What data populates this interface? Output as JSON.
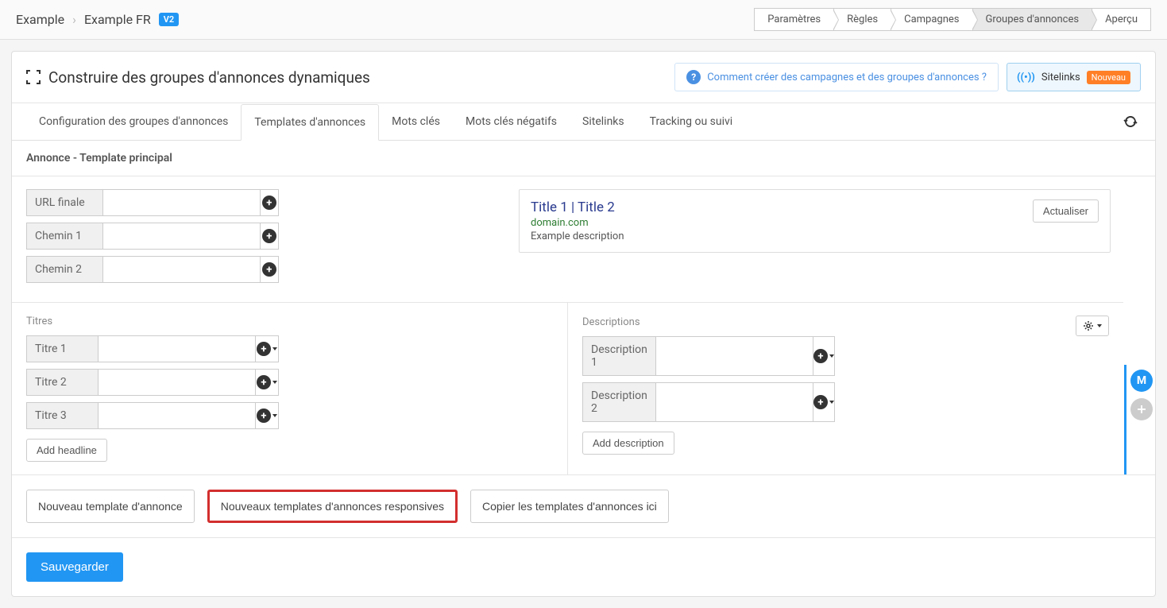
{
  "breadcrumb": {
    "item1": "Example",
    "item2": "Example FR",
    "badge": "V2"
  },
  "steps": {
    "parametres": "Paramètres",
    "regles": "Règles",
    "campagnes": "Campagnes",
    "groupes": "Groupes d'annonces",
    "apercu": "Aperçu"
  },
  "header": {
    "title": "Construire des groupes d'annonces dynamiques",
    "help": "Comment créer des campagnes et des groupes d'annonces ?",
    "sitelinks": "Sitelinks",
    "nouveau": "Nouveau"
  },
  "tabs": {
    "config": "Configuration des groupes d'annonces",
    "templates": "Templates d'annonces",
    "mots": "Mots clés",
    "negatifs": "Mots clés négatifs",
    "sitelinks": "Sitelinks",
    "tracking": "Tracking ou suivi"
  },
  "section": {
    "title": "Annonce - Template principal"
  },
  "fields": {
    "url_finale": "URL finale",
    "chemin1": "Chemin 1",
    "chemin2": "Chemin 2"
  },
  "titres_section": "Titres",
  "titres": {
    "t1": "Titre 1",
    "t2": "Titre 2",
    "t3": "Titre 3"
  },
  "add_headline": "Add headline",
  "descriptions_section": "Descriptions",
  "descriptions": {
    "d1": "Description 1",
    "d2": "Description 2"
  },
  "add_description": "Add description",
  "preview": {
    "title": "Title 1 | Title 2",
    "domain": "domain.com",
    "desc": "Example description",
    "refresh": "Actualiser"
  },
  "actions": {
    "nouveau_template": "Nouveau template d'annonce",
    "nouveaux_responsive": "Nouveaux templates d'annonces responsives",
    "copier": "Copier les templates d'annonces ici",
    "save": "Sauvegarder"
  },
  "rail": {
    "m": "M"
  }
}
